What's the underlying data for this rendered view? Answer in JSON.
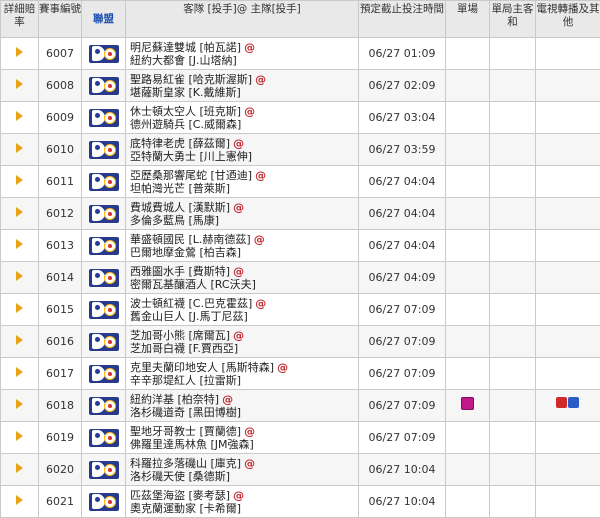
{
  "headers": {
    "detail": "詳細賠率",
    "match_no": "賽事編號",
    "league": "聯盟",
    "teams": "客隊 [投手]@ 主隊[投手]",
    "deadline": "預定截止投注時間",
    "single": "單場",
    "single_game": "單局主客和",
    "tv": "電視轉播及其他"
  },
  "colors": {
    "accent_blue": "#1d4fb3",
    "at_red": "#c0272d",
    "arrow_orange": "#e9a21a",
    "badge_magenta": "#c2188b"
  },
  "rows": [
    {
      "no": "6007",
      "away": "明尼蘇達雙城 [帕瓦諾]",
      "at": "@",
      "home": "紐約大都會 [J.山塔納]",
      "time": "06/27 01:09"
    },
    {
      "no": "6008",
      "away": "聖路易紅雀 [哈克斯渥斯]",
      "at": "@",
      "home": "堪薩斯皇家 [K.戴維斯]",
      "time": "06/27 02:09"
    },
    {
      "no": "6009",
      "away": "休士頓太空人 [班克斯]",
      "at": "@",
      "home": "德州遊騎兵 [C.威爾森]",
      "time": "06/27 03:04"
    },
    {
      "no": "6010",
      "away": "底特律老虎 [薛茲爾]",
      "at": "@",
      "home": "亞特蘭大勇士 [川上憲伸]",
      "time": "06/27 03:59"
    },
    {
      "no": "6011",
      "away": "亞歷桑那響尾蛇 [甘迺迪]",
      "at": "@",
      "home": "坦帕灣光芒 [普萊斯]",
      "time": "06/27 04:04"
    },
    {
      "no": "6012",
      "away": "費城費城人 [漢默斯]",
      "at": "@",
      "home": "多倫多藍鳥 [馬康]",
      "time": "06/27 04:04"
    },
    {
      "no": "6013",
      "away": "華盛頓國民 [L.赫南德茲]",
      "at": "@",
      "home": "巴爾地摩金鶯 [柏吉森]",
      "time": "06/27 04:04"
    },
    {
      "no": "6014",
      "away": "西雅圖水手 [費斯特]",
      "at": "@",
      "home": "密爾瓦基釀酒人 [RC沃夫]",
      "time": "06/27 04:09"
    },
    {
      "no": "6015",
      "away": "波士頓紅襪 [C.巴克霍茲]",
      "at": "@",
      "home": "舊金山巨人 [J.馬丁尼茲]",
      "time": "06/27 07:09"
    },
    {
      "no": "6016",
      "away": "芝加哥小熊 [席爾瓦]",
      "at": "@",
      "home": "芝加哥白襪 [F.賈西亞]",
      "time": "06/27 07:09"
    },
    {
      "no": "6017",
      "away": "克里夫蘭印地安人 [馬斯特森]",
      "at": "@",
      "home": "辛辛那堤紅人 [拉雷斯]",
      "time": "06/27 07:09"
    },
    {
      "no": "6018",
      "away": "紐約洋基 [柏奈特]",
      "at": "@",
      "home": "洛杉磯道奇 [黑田博樹]",
      "time": "06/27 07:09",
      "single": "單",
      "tv": [
        "新",
        "民"
      ]
    },
    {
      "no": "6019",
      "away": "聖地牙哥教士 [賈蘭德]",
      "at": "@",
      "home": "佛羅里達馬林魚 [JM強森]",
      "time": "06/27 07:09"
    },
    {
      "no": "6020",
      "away": "科羅拉多落磯山 [庫克]",
      "at": "@",
      "home": "洛杉磯天使 [桑德斯]",
      "time": "06/27 10:04"
    },
    {
      "no": "6021",
      "away": "匹茲堡海盜 [麥考瑟]",
      "at": "@",
      "home": "奧克蘭運動家 [卡希爾]",
      "time": "06/27 10:04"
    }
  ]
}
